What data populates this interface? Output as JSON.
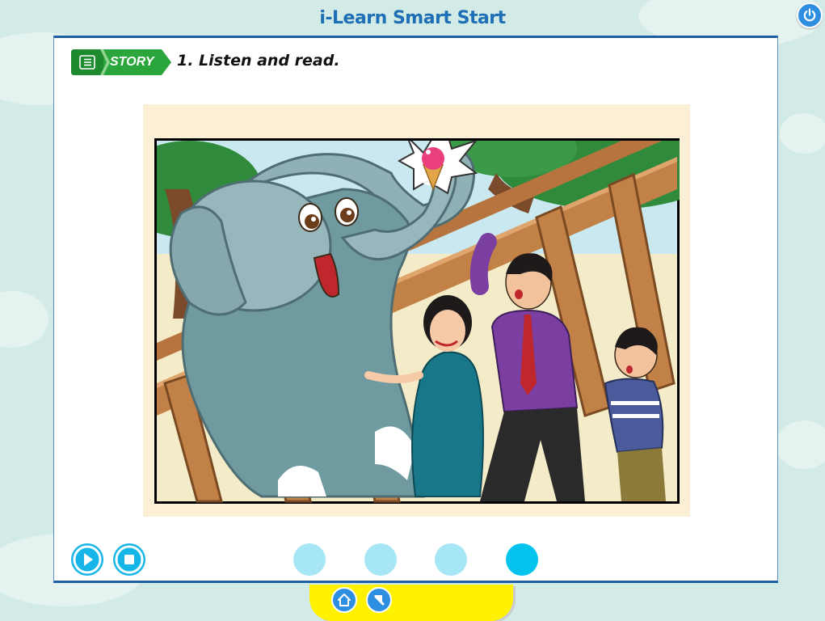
{
  "app": {
    "title": "i-Learn Smart Start"
  },
  "header": {
    "power_icon": "power-icon"
  },
  "lesson": {
    "section_badge": "STORY",
    "section_icon": "list-icon",
    "instruction": "1. Listen and read."
  },
  "illustration": {
    "characters": [
      "elephant",
      "woman",
      "man",
      "boy"
    ],
    "prop": "ice-cream-cone"
  },
  "player": {
    "play_icon": "play-icon",
    "stop_icon": "stop-icon"
  },
  "pagination": {
    "total": 4,
    "current": 4
  },
  "bottom_nav": {
    "home_icon": "home-icon",
    "back_icon": "back-arrow-icon"
  },
  "colors": {
    "background": "#d3ebe6",
    "title": "#1e6fb6",
    "accent": "#16b5e8",
    "badge_green": "#2aa63c",
    "bottom_tab": "#fff200",
    "panel_border": "#1c5fa8"
  }
}
